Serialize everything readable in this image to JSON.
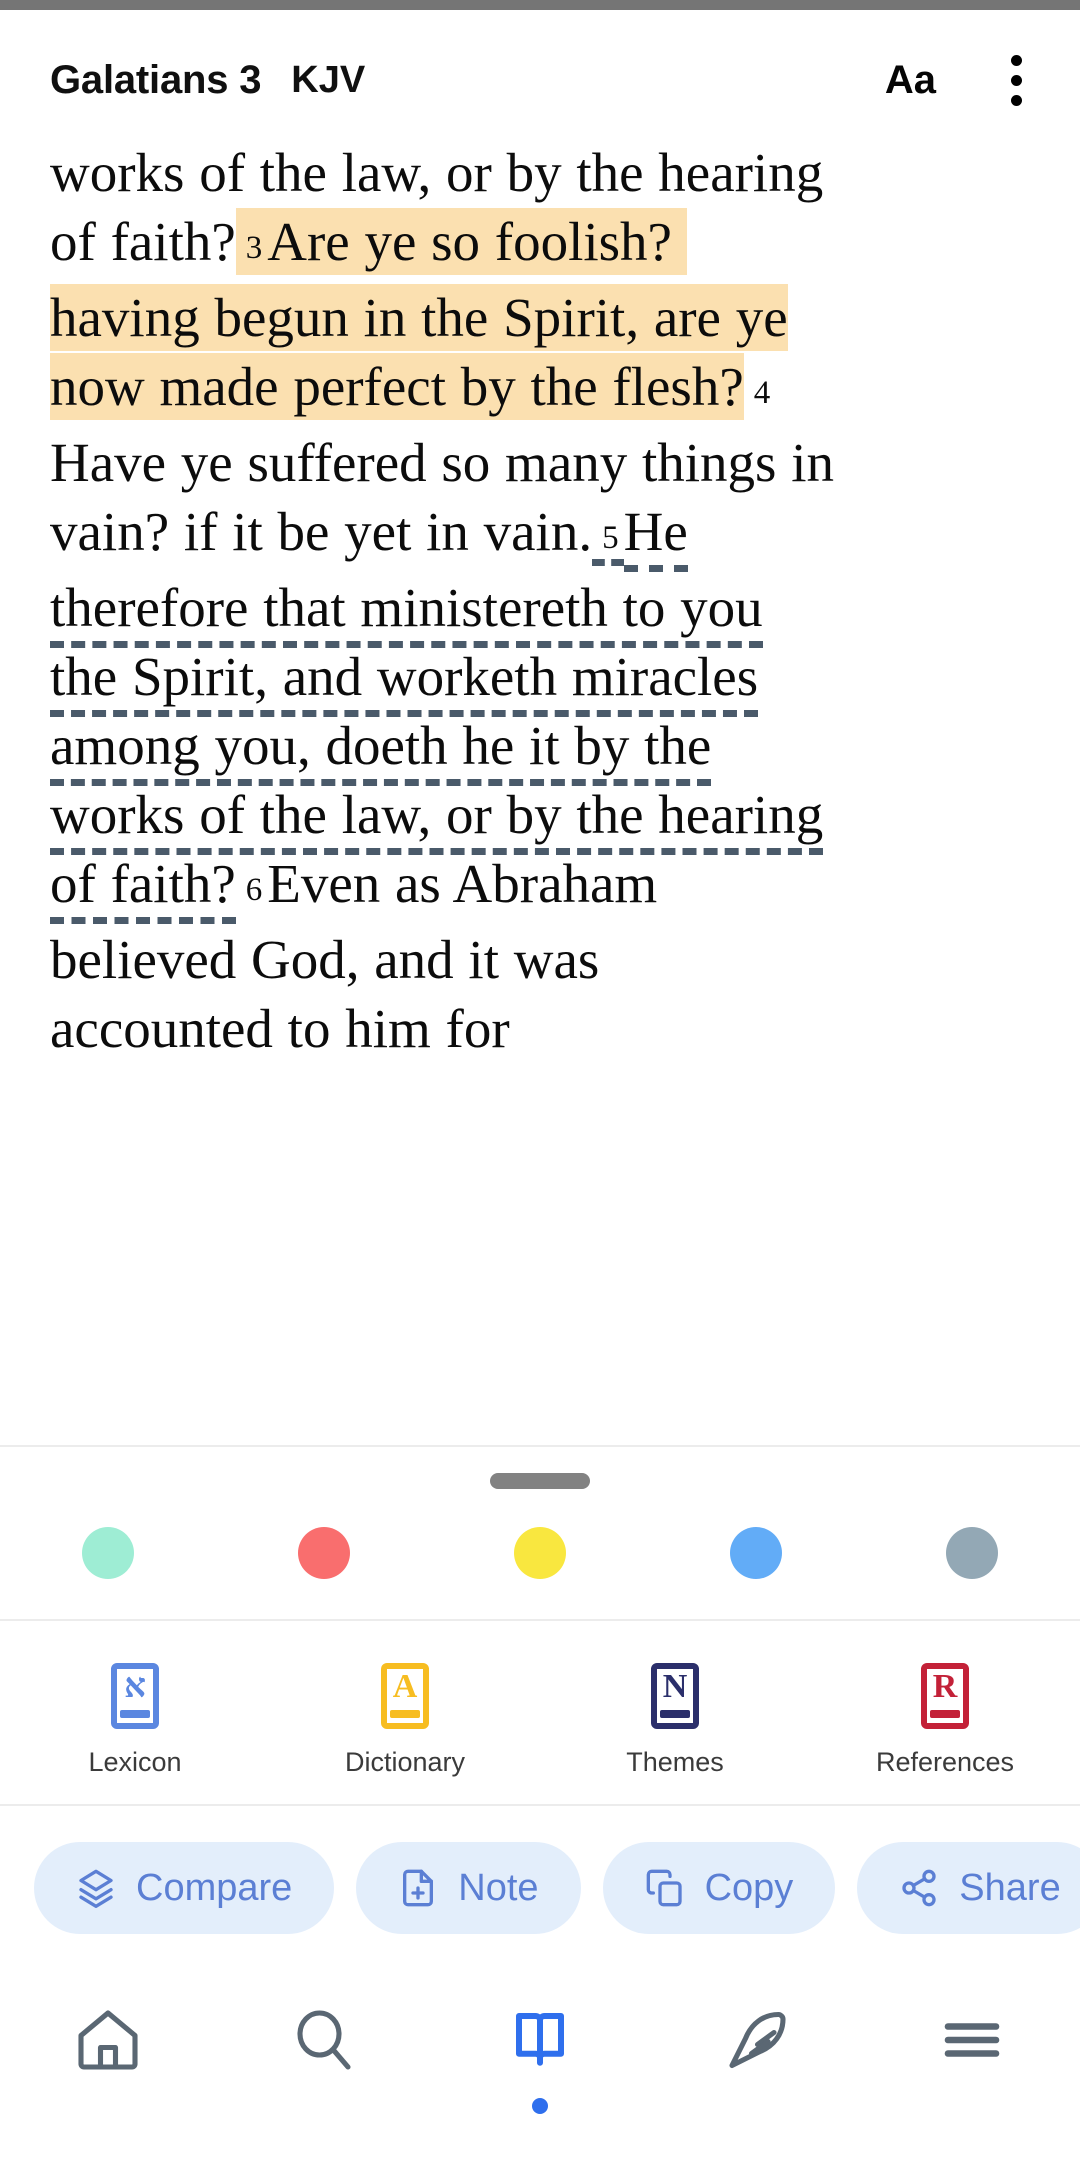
{
  "header": {
    "reference": "Galatians 3",
    "version": "KJV",
    "font_size_button": "Aa",
    "menu_icon": "kebab-menu-icon"
  },
  "scripture": {
    "segments": [
      {
        "text": "works of the law, or by the hearing of faith?",
        "style": "plain"
      },
      {
        "text": "3",
        "style": "verse-number-highlighted"
      },
      {
        "text": "Are ye so foolish? having begun in the Spirit, are ye now made perfect by the flesh?",
        "style": "highlighted"
      },
      {
        "text": "4",
        "style": "verse-number"
      },
      {
        "text": "Have ye suffered so many things in vain? if it be yet in vain.",
        "style": "plain"
      },
      {
        "text": "5",
        "style": "verse-number-underlined"
      },
      {
        "text": "He therefore that ministereth to you the Spirit, and worketh miracles among you, doeth he it by the works of the law, or by the hearing of faith?",
        "style": "dashed-underline"
      },
      {
        "text": "6",
        "style": "verse-number"
      },
      {
        "text": "Even as Abraham believed God, and it was accounted to him for",
        "style": "partial-underline"
      }
    ],
    "line1": "works of the law, or by the hearing",
    "line2_pre": "of faith?",
    "line2_num": "3",
    "line2_hl": "Are ye so foolish?",
    "line3_hl": "having begun in the Spirit, are ye",
    "line4_hl": "now made perfect by the flesh?",
    "line4_num": "4",
    "line5": "Have ye suffered so many things in",
    "line6_pre": "vain? if it be yet in vain.",
    "line6_num": "5",
    "line6_post": "He",
    "line7": "therefore that ministereth to you",
    "line8": "the Spirit, and worketh miracles",
    "line9": "among you, doeth he it by the",
    "line10": "works of the law, or by the hearing",
    "line11_pre": "of faith?",
    "line11_num": "6",
    "line11_post": "Even as Abraham",
    "line12": "believed God, and it was",
    "line13": "accounted to him for",
    "highlight_color": "#FBE0B0",
    "underline_color": "#4a5a6a",
    "text_color": "#0c0c0c"
  },
  "sheet": {
    "grabber": "drag-handle"
  },
  "highlight_colors": [
    {
      "name": "mint",
      "hex": "#9EEDD4"
    },
    {
      "name": "red",
      "hex": "#F96E6E"
    },
    {
      "name": "yellow",
      "hex": "#F9E73F"
    },
    {
      "name": "blue",
      "hex": "#62ACF7"
    },
    {
      "name": "slate",
      "hex": "#93A8B5"
    }
  ],
  "tools": [
    {
      "label": "Lexicon",
      "glyph": "א",
      "color": "#5B87E0",
      "icon": "lexicon-book-icon"
    },
    {
      "label": "Dictionary",
      "glyph": "A",
      "color": "#F7BD21",
      "icon": "dictionary-book-icon"
    },
    {
      "label": "Themes",
      "glyph": "N",
      "color": "#2B2F6B",
      "icon": "themes-book-icon"
    },
    {
      "label": "References",
      "glyph": "R",
      "color": "#C32138",
      "icon": "references-book-icon"
    }
  ],
  "chips": [
    {
      "label": "Compare",
      "icon": "layers-icon"
    },
    {
      "label": "Note",
      "icon": "note-add-icon"
    },
    {
      "label": "Copy",
      "icon": "copy-icon"
    },
    {
      "label": "Share",
      "icon": "share-icon"
    }
  ],
  "chip_colors": {
    "background": "#E3EEFB",
    "foreground": "#5B7FD4"
  },
  "bottom_nav": [
    {
      "name": "home",
      "icon": "home-icon",
      "active": false
    },
    {
      "name": "search",
      "icon": "search-icon",
      "active": false
    },
    {
      "name": "read",
      "icon": "open-book-icon",
      "active": true
    },
    {
      "name": "notes",
      "icon": "feather-quill-icon",
      "active": false
    },
    {
      "name": "more",
      "icon": "hamburger-menu-icon",
      "active": false
    }
  ],
  "nav_colors": {
    "active": "#2F6FED",
    "inactive": "#5A6773"
  }
}
